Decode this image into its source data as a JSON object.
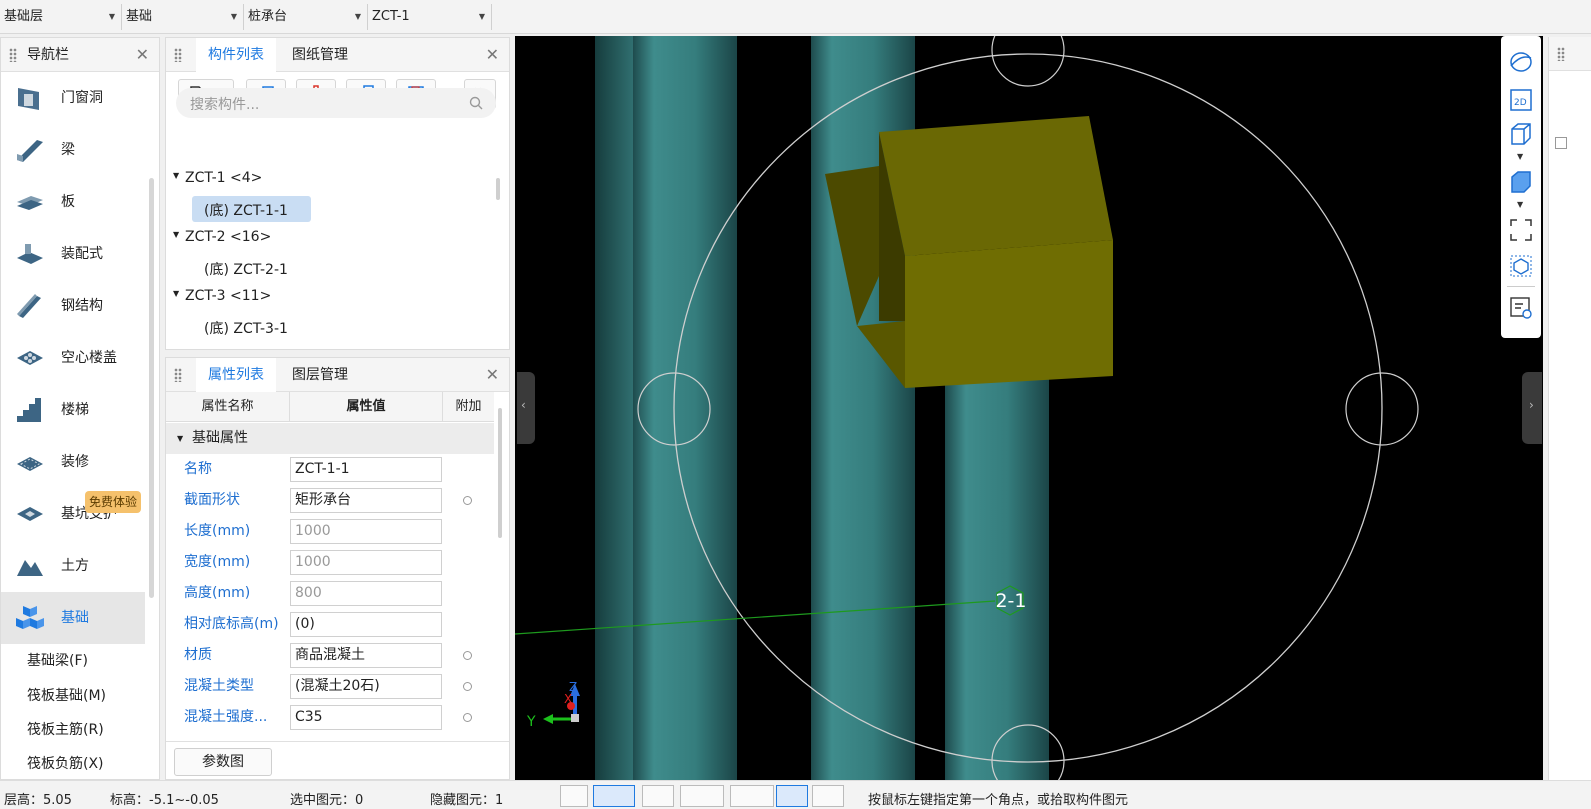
{
  "top_selectors": [
    {
      "value": "基础层"
    },
    {
      "value": "基础"
    },
    {
      "value": "桩承台"
    },
    {
      "value": "ZCT-1"
    }
  ],
  "nav": {
    "title": "导航栏",
    "items": [
      {
        "label": "门窗洞",
        "icon": "door-window-icon"
      },
      {
        "label": "梁",
        "icon": "beam-icon"
      },
      {
        "label": "板",
        "icon": "slab-icon"
      },
      {
        "label": "装配式",
        "icon": "prefab-icon"
      },
      {
        "label": "钢结构",
        "icon": "steel-icon"
      },
      {
        "label": "空心楼盖",
        "icon": "hollow-floor-icon"
      },
      {
        "label": "楼梯",
        "icon": "stairs-icon"
      },
      {
        "label": "装修",
        "icon": "decoration-icon"
      },
      {
        "label": "基坑支护",
        "icon": "pit-support-icon"
      },
      {
        "label": "土方",
        "icon": "earthwork-icon"
      },
      {
        "label": "基础",
        "icon": "foundation-icon"
      }
    ],
    "badge": "免费体验",
    "sub_items": [
      "基础梁(F)",
      "筏板基础(M)",
      "筏板主筋(R)",
      "筏板负筋(X)"
    ]
  },
  "component_panel": {
    "tabs": [
      "构件列表",
      "图纸管理"
    ],
    "search_placeholder": "搜索构件...",
    "tree": [
      {
        "label": "ZCT-1 <4>",
        "children": [
          "(底) ZCT-1-1"
        ]
      },
      {
        "label": "ZCT-2 <16>",
        "children": [
          "(底) ZCT-2-1"
        ]
      },
      {
        "label": "ZCT-3 <11>",
        "children": [
          "(底) ZCT-3-1"
        ]
      }
    ]
  },
  "property_panel": {
    "tabs": [
      "属性列表",
      "图层管理"
    ],
    "columns": [
      "属性名称",
      "属性值",
      "附加"
    ],
    "group": "基础属性",
    "rows": [
      {
        "name": "名称",
        "value": "ZCT-1-1"
      },
      {
        "name": "截面形状",
        "value": "矩形承台"
      },
      {
        "name": "长度(mm)",
        "value": "1000"
      },
      {
        "name": "宽度(mm)",
        "value": "1000"
      },
      {
        "name": "高度(mm)",
        "value": "800"
      },
      {
        "name": "相对底标高(m)",
        "value": "(0)"
      },
      {
        "name": "材质",
        "value": "商品混凝土"
      },
      {
        "name": "混凝土类型",
        "value": "(混凝土20石)"
      },
      {
        "name": "混凝土强度...",
        "value": "C35"
      }
    ],
    "param_button": "参数图"
  },
  "viewport": {
    "axis_label": "2-1",
    "axis_x": "X",
    "axis_y": "Y",
    "axis_z": "Z"
  },
  "status": {
    "floor_height": "层高：5.05",
    "elevation": "标高：-5.1~-0.05",
    "selected": "选中图元：0",
    "hidden": "隐藏图元：1",
    "hint": "按鼠标左键指定第一个角点，或拾取构件图元"
  }
}
